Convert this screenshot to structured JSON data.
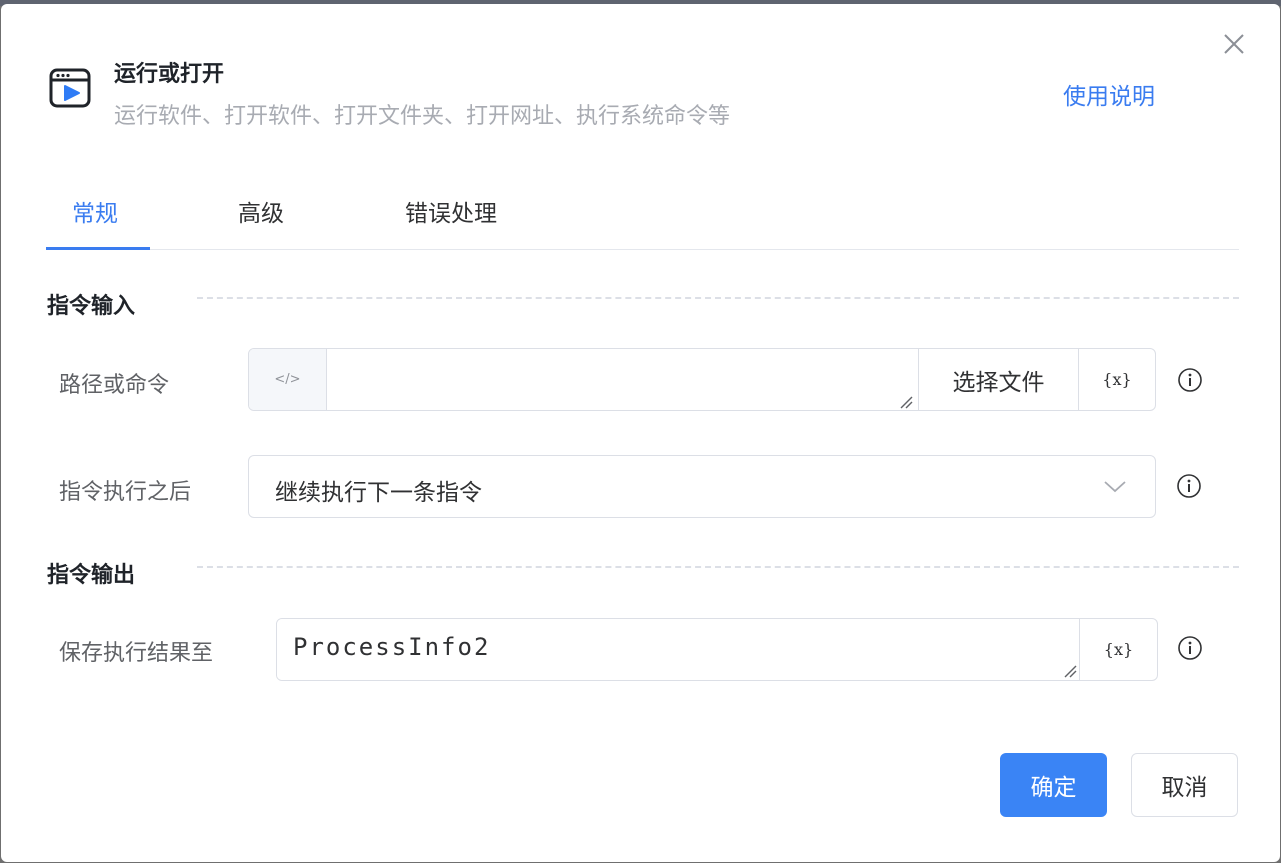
{
  "dialog": {
    "title": "运行或打开",
    "subtitle": "运行软件、打开软件、打开文件夹、打开网址、执行系统命令等",
    "help_link": "使用说明"
  },
  "tabs": [
    {
      "label": "常规",
      "active": true
    },
    {
      "label": "高级",
      "active": false
    },
    {
      "label": "错误处理",
      "active": false
    }
  ],
  "sections": {
    "input_title": "指令输入",
    "output_title": "指令输出"
  },
  "fields": {
    "path": {
      "label": "路径或命令",
      "value": "",
      "code_toggle": "</>",
      "select_file_label": "选择文件",
      "variable_label": "{x}"
    },
    "after_exec": {
      "label": "指令执行之后",
      "selected": "继续执行下一条指令"
    },
    "save_result": {
      "label": "保存执行结果至",
      "value": "ProcessInfo2",
      "variable_label": "{x}"
    }
  },
  "footer": {
    "confirm_label": "确定",
    "cancel_label": "取消"
  },
  "colors": {
    "accent": "#3a7cf0",
    "primary_button": "#3a84f5",
    "border": "#dcdfe6",
    "muted_text": "#a8abb2"
  },
  "icons": {
    "app": "run-window-play-icon",
    "close": "close-icon",
    "info": "info-circle-icon",
    "dropdown": "chevron-down-icon"
  }
}
